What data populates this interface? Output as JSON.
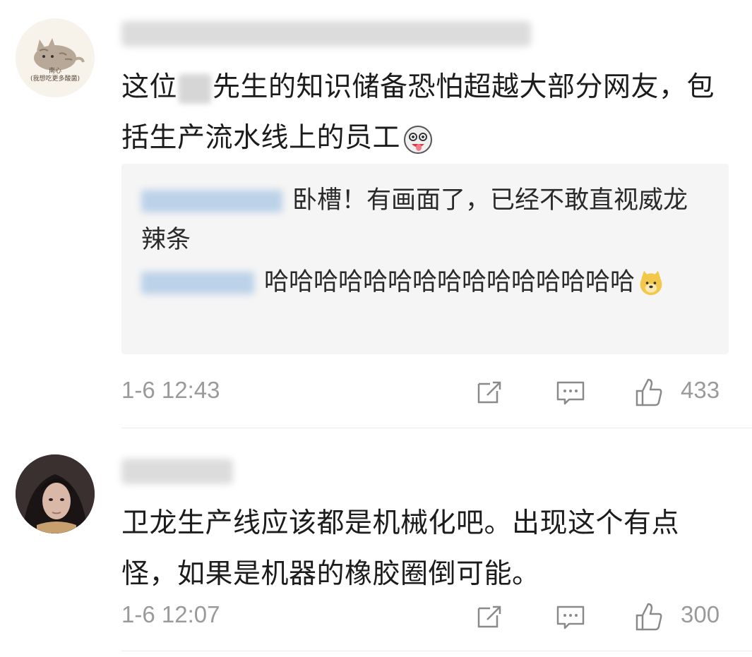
{
  "comments": [
    {
      "avatar_caption": "南心\n(我想吃更多酸菌)",
      "text_before": "这位",
      "text_after": "先生的知识储备恐怕超越大部分网友，包括生产流水线上的员工",
      "emoji": "husky-laugh-emoji",
      "replies": [
        {
          "text": "卧槽！有画面了，已经不敢直视威龙辣条"
        },
        {
          "text": "哈哈哈哈哈哈哈哈哈哈哈哈哈哈哈",
          "emoji": "doge-emoji"
        }
      ],
      "time": "1-6 12:43",
      "likes": "433"
    },
    {
      "text": "卫龙生产线应该都是机械化吧。出现这个有点怪，如果是机器的橡胶圈倒可能。",
      "time": "1-6 12:07",
      "likes": "300"
    }
  ],
  "icons": {
    "share": "share-icon",
    "reply": "comment-icon",
    "like": "thumbs-up-icon"
  },
  "colors": {
    "meta_gray": "#9a9a9a",
    "reply_bg": "#f5f5f5"
  }
}
